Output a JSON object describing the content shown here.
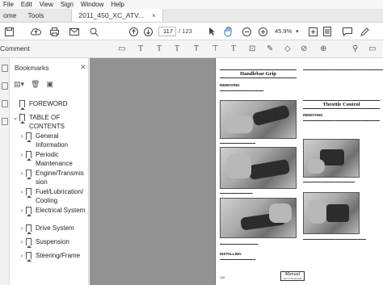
{
  "menubar": {
    "items": [
      "File",
      "Edit",
      "View",
      "Sign",
      "Window",
      "Help"
    ]
  },
  "tabs": {
    "home": "ome",
    "tools": "Tools",
    "document": "2011_450_XC_ATV...",
    "close": "×"
  },
  "toolbar": {
    "current_page": "117",
    "page_total": "/ 123",
    "zoom": "45.9%",
    "icons": [
      "save-icon",
      "upload-icon",
      "print-icon",
      "mail-icon",
      "search-icon",
      "page-up-icon",
      "page-down-icon",
      "select-arrow-icon",
      "hand-icon",
      "zoom-out-icon",
      "zoom-in-icon",
      "zoom-dropdown-icon",
      "fit-icon",
      "scroll-icon",
      "comment-icon",
      "pen-icon"
    ]
  },
  "commentbar": {
    "title": "Comment"
  },
  "bookmarks": {
    "title": "Bookmarks",
    "items": [
      {
        "label": "FOREWORD",
        "expandable": false,
        "indent": 0
      },
      {
        "label": "TABLE OF CONTENTS",
        "expandable": true,
        "expanded": true,
        "indent": 0
      },
      {
        "label": "General Information",
        "expandable": true,
        "indent": 1
      },
      {
        "label": "Periodic Maintenance",
        "expandable": true,
        "indent": 1
      },
      {
        "label": "Engine/Transmission",
        "expandable": true,
        "indent": 1
      },
      {
        "label": "Fuel/Lubrication/Cooling",
        "expandable": true,
        "indent": 1
      },
      {
        "label": "Electrical System",
        "expandable": true,
        "indent": 1
      },
      {
        "label": "Drive System",
        "expandable": true,
        "indent": 1
      },
      {
        "label": "Suspension",
        "expandable": true,
        "indent": 1
      },
      {
        "label": "Steering/Frame",
        "expandable": true,
        "indent": 1
      }
    ]
  },
  "document": {
    "left_title": "Handlebar Grip",
    "left_sub1": "REMOVING",
    "left_sub2": "INSTALLING",
    "right_title": "Throttle Control",
    "right_sub1": "REMOVING",
    "page_number": "116",
    "logo": "Manual",
    "logo_sub": "Sets of Downloads"
  }
}
